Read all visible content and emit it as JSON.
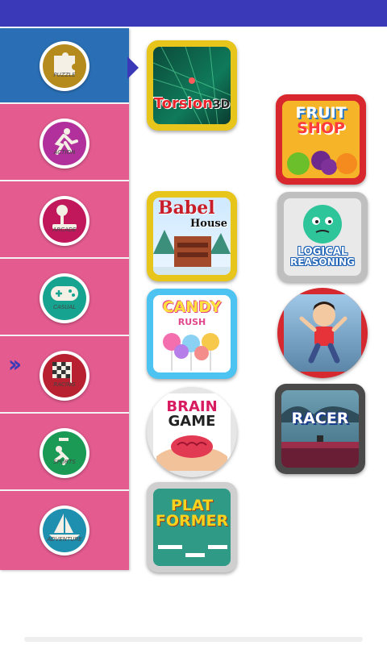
{
  "categories": [
    {
      "label": "PUZZLE",
      "icon": "puzzle-icon",
      "color": "#b58b1e"
    },
    {
      "label": "ACTION",
      "icon": "action-icon",
      "color": "#b2309b"
    },
    {
      "label": "ARCADE",
      "icon": "arcade-icon",
      "color": "#c0185b"
    },
    {
      "label": "CASUAL",
      "icon": "casual-icon",
      "color": "#16a38f"
    },
    {
      "label": "RACING",
      "icon": "racing-icon",
      "color": "#b72130"
    },
    {
      "label": "SPORTS",
      "icon": "sports-icon",
      "color": "#1a9a55"
    },
    {
      "label": "ADVENTURE",
      "icon": "adventure-icon",
      "color": "#1f8fb0"
    }
  ],
  "selected_category": "PUZZLE",
  "games": {
    "torsion": {
      "title": "Torsion",
      "suffix": "3D"
    },
    "fruit_shop": {
      "line1": "FRUIT",
      "line2": "SHOP"
    },
    "babel_house": {
      "line1": "Babel",
      "line2": "House"
    },
    "logical_reasoning": {
      "line1": "LOGICAL",
      "line2": "REASONING"
    },
    "candy_rush": {
      "line1": "CANDY",
      "line2": "RUSH"
    },
    "brain_game": {
      "line1": "BRAIN",
      "line2": "GAME"
    },
    "racer": {
      "title": "RACER"
    },
    "platformer": {
      "line1": "PLAT",
      "line2": "FORMER"
    }
  },
  "colors": {
    "status_bar": "#3a3ab8",
    "sidebar_bg": "#e35b8f",
    "sidebar_selected": "#2a6fb5"
  }
}
